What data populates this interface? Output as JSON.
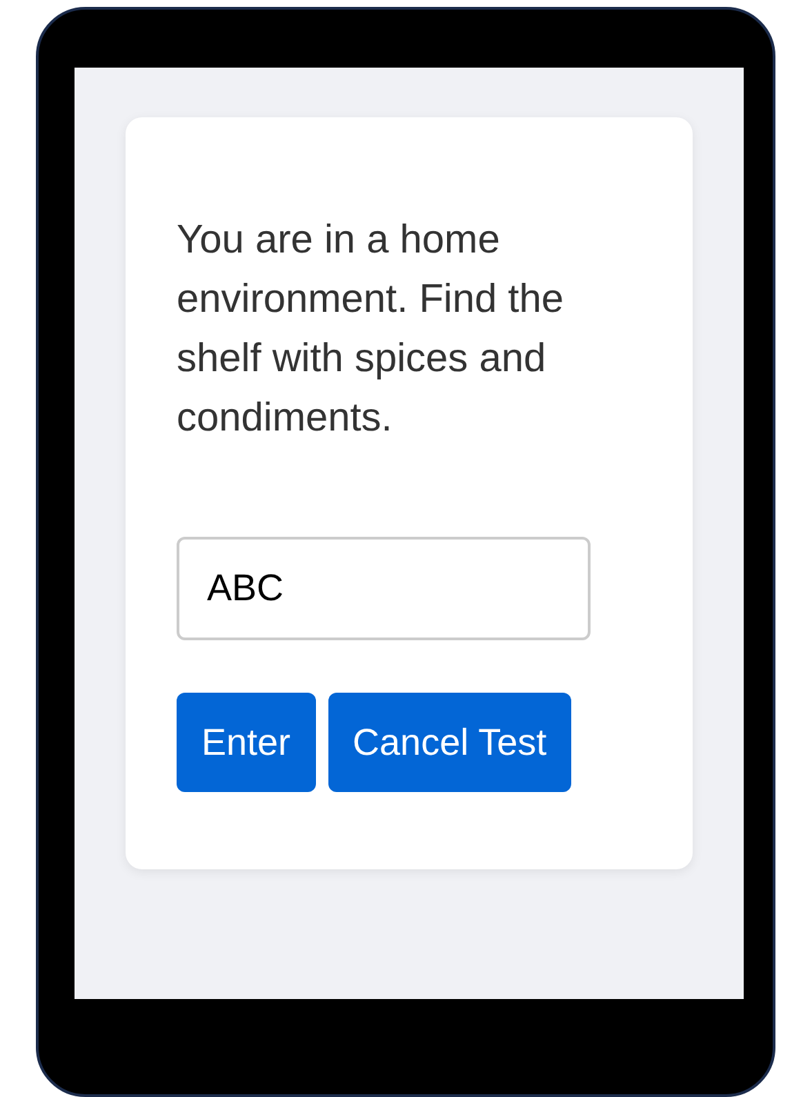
{
  "prompt": "You are in a home environment. Find the shelf with spices and condiments.",
  "answer_field": {
    "value": "ABC"
  },
  "buttons": [
    {
      "label": "Enter"
    },
    {
      "label": "Cancel Test"
    }
  ]
}
